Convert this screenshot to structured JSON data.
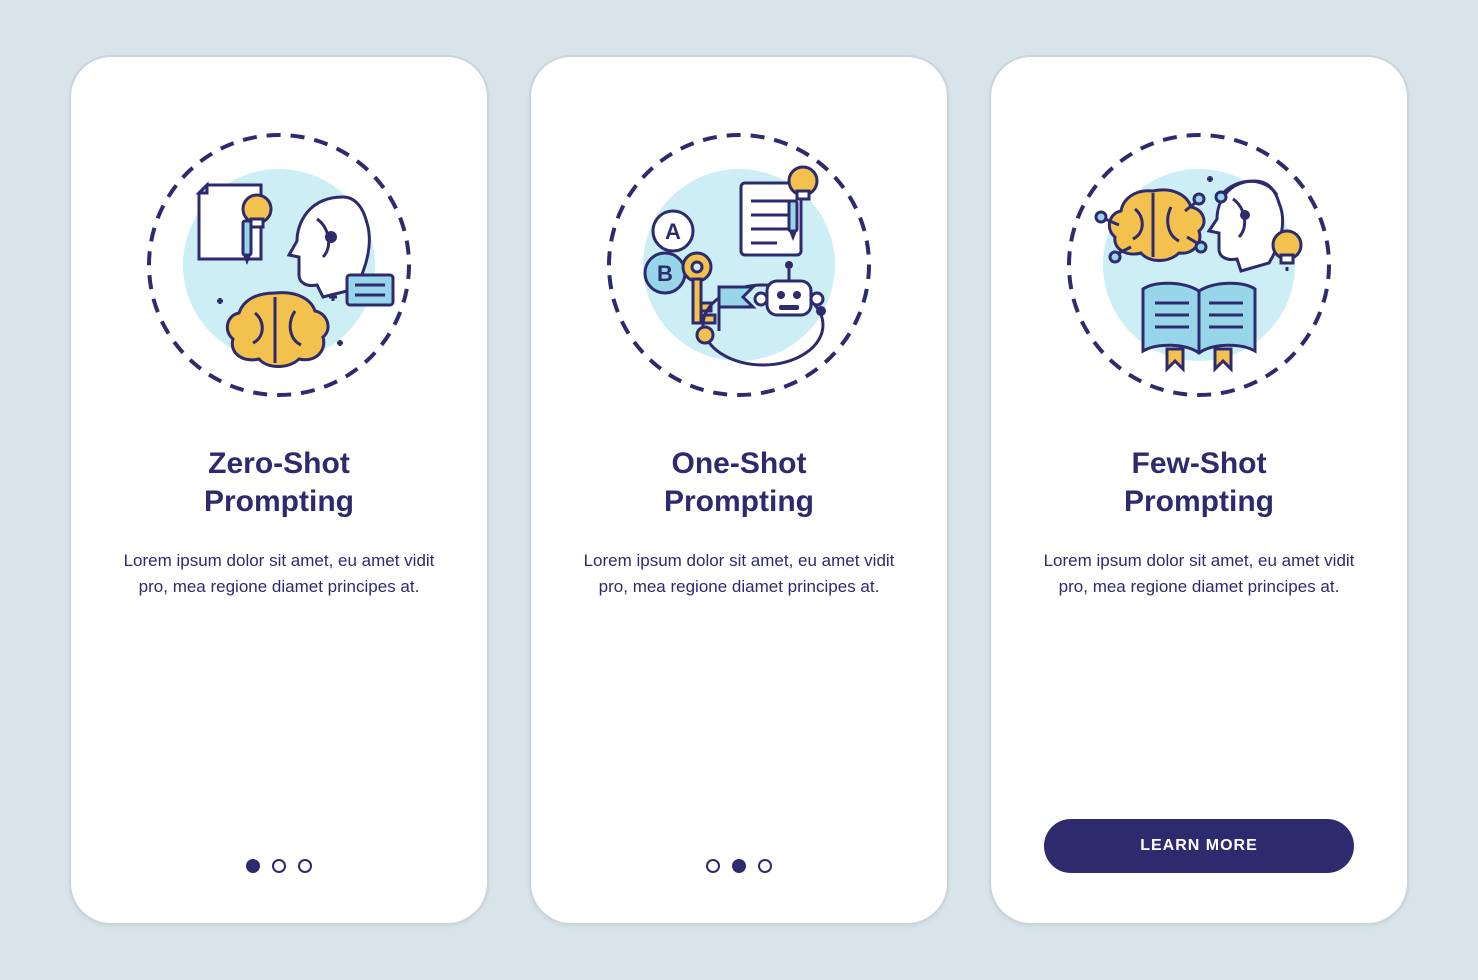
{
  "colors": {
    "background": "#d9e4ea",
    "card": "#ffffff",
    "primary": "#2d2a6e",
    "accentYellow": "#f2c14e",
    "accentBlue": "#96d6e8",
    "lightBlue": "#cdeef5",
    "stroke": "#2d2a6e"
  },
  "screens": [
    {
      "icon_name": "zero-shot-icon",
      "title": "Zero-Shot Prompting",
      "description": "Lorem ipsum dolor sit amet, eu amet vidit pro, mea regione diamet principes at.",
      "page_index": 0,
      "page_count": 3,
      "cta": null
    },
    {
      "icon_name": "one-shot-icon",
      "title": "One-Shot Prompting",
      "description": "Lorem ipsum dolor sit amet, eu amet vidit pro, mea regione diamet principes at.",
      "page_index": 1,
      "page_count": 3,
      "cta": null
    },
    {
      "icon_name": "few-shot-icon",
      "title": "Few-Shot Prompting",
      "description": "Lorem ipsum dolor sit amet, eu amet vidit pro, mea regione diamet principes at.",
      "page_index": 2,
      "page_count": 3,
      "cta": "LEARN MORE"
    }
  ]
}
